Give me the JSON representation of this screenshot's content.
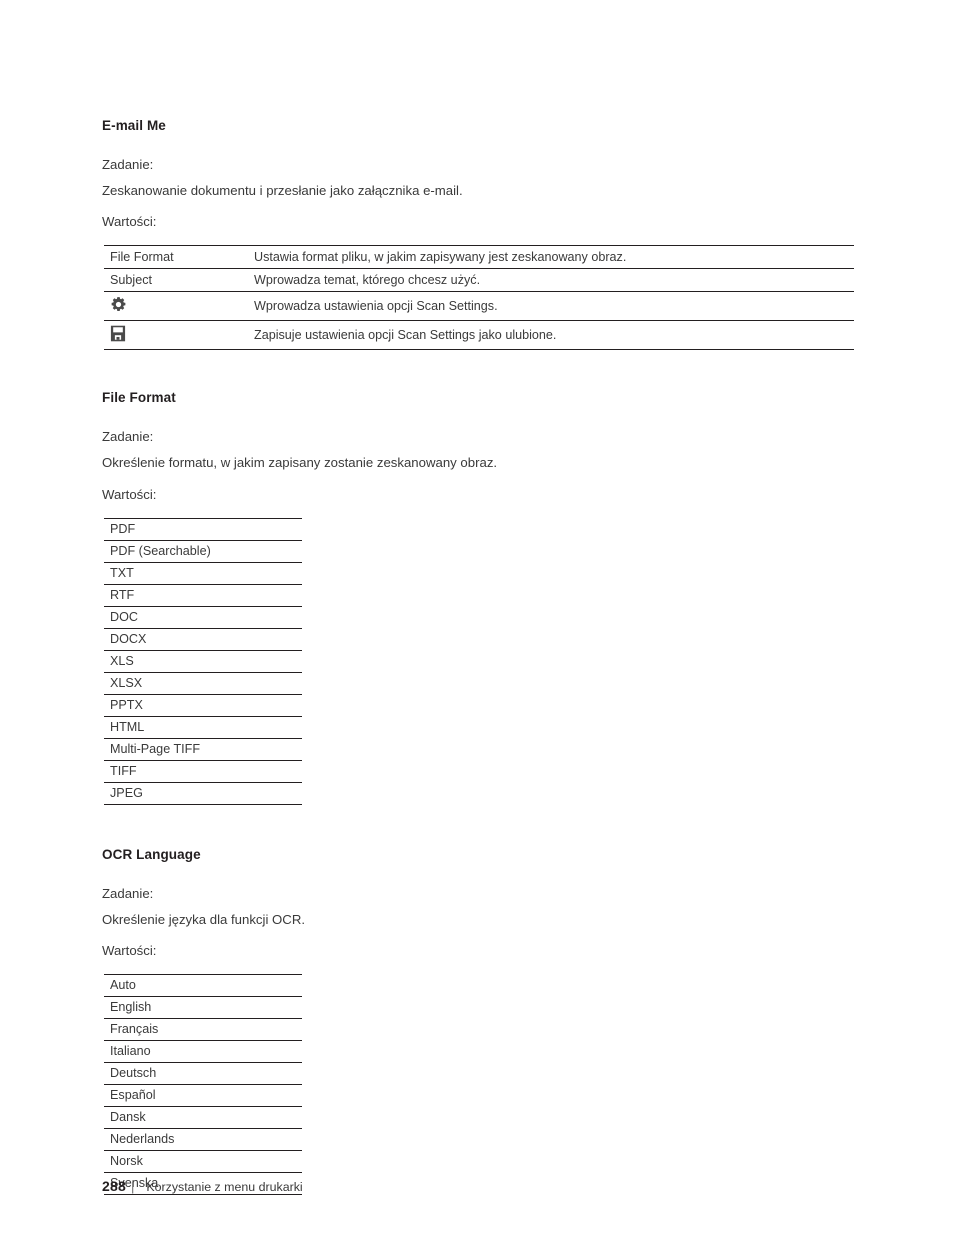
{
  "document": {
    "language": "pl",
    "text_color": "#3a3a3a",
    "heading_color": "#231f20",
    "rule_color": "#231f20"
  },
  "sections": [
    {
      "title": "E-mail Me",
      "purpose_label": "Zadanie:",
      "purpose_text": "Zeskanowanie dokumentu i przesłanie jako załącznika e-mail.",
      "values_label": "Wartości:",
      "table_type": "two-column",
      "rows": [
        {
          "key": "File Format",
          "icon": null,
          "value": "Ustawia format pliku, w jakim zapisywany jest zeskanowany obraz."
        },
        {
          "key": "Subject",
          "icon": null,
          "value": "Wprowadza temat, którego chcesz użyć."
        },
        {
          "key": "",
          "icon": "gear-icon",
          "value": "Wprowadza ustawienia opcji Scan Settings."
        },
        {
          "key": "",
          "icon": "floppy-disk-save-icon",
          "value": "Zapisuje ustawienia opcji Scan Settings jako ulubione."
        }
      ]
    },
    {
      "title": "File Format",
      "purpose_label": "Zadanie:",
      "purpose_text": "Określenie formatu, w jakim zapisany zostanie zeskanowany obraz.",
      "values_label": "Wartości:",
      "table_type": "value-list",
      "values": [
        "PDF",
        "PDF (Searchable)",
        "TXT",
        "RTF",
        "DOC",
        "DOCX",
        "XLS",
        "XLSX",
        "PPTX",
        "HTML",
        "Multi-Page TIFF",
        "TIFF",
        "JPEG"
      ]
    },
    {
      "title": "OCR Language",
      "purpose_label": "Zadanie:",
      "purpose_text": "Określenie języka dla funkcji OCR.",
      "values_label": "Wartości:",
      "table_type": "value-list",
      "values": [
        "Auto",
        "English",
        "Français",
        "Italiano",
        "Deutsch",
        "Español",
        "Dansk",
        "Nederlands",
        "Norsk",
        "Svenska"
      ]
    }
  ],
  "footer": {
    "page_number": "288",
    "separator": "|",
    "text": "Korzystanie z menu drukarki"
  }
}
